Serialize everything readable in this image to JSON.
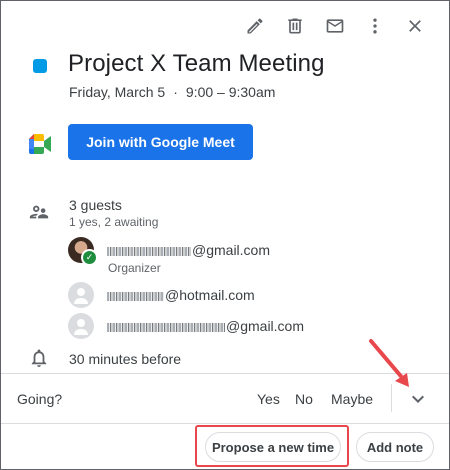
{
  "event": {
    "color": "#039be5",
    "title": "Project X Team Meeting",
    "date": "Friday, March 5",
    "separator": "·",
    "time": "9:00 – 9:30am"
  },
  "toolbar": {
    "icons": [
      "edit-icon",
      "delete-icon",
      "email-icon",
      "more-icon",
      "close-icon"
    ]
  },
  "meet": {
    "button_label": "Join with Google Meet",
    "color": "#1a73e8"
  },
  "guests": {
    "count_label": "3 guests",
    "status_label": "1 yes, 2 awaiting",
    "list": [
      {
        "email_visible": "@gmail.com",
        "role": "Organizer",
        "status": "accepted"
      },
      {
        "email_visible": "@hotmail.com",
        "role": "",
        "status": "awaiting"
      },
      {
        "email_visible": "@gmail.com",
        "role": "",
        "status": "awaiting"
      }
    ]
  },
  "reminder": {
    "label": "30 minutes before"
  },
  "rsvp": {
    "question": "Going?",
    "yes": "Yes",
    "no": "No",
    "maybe": "Maybe"
  },
  "actions": {
    "propose_label": "Propose a new time",
    "note_label": "Add note",
    "highlight_color": "#e8474c"
  }
}
